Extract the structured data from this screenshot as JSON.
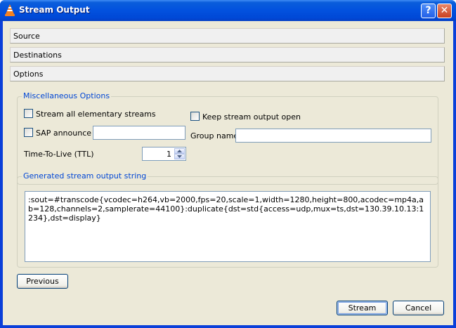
{
  "window": {
    "title": "Stream Output",
    "help_label": "?",
    "close_label": "✕",
    "colors": {
      "titlebar": "#0251de",
      "client": "#ece9d8",
      "accent_text": "#0046d5"
    }
  },
  "sections": {
    "source": "Source",
    "destinations": "Destinations",
    "options": "Options"
  },
  "misc": {
    "legend": "Miscellaneous Options",
    "stream_all_label": "Stream all elementary streams",
    "stream_all_checked": false,
    "keep_open_label": "Keep stream output open",
    "keep_open_checked": false,
    "sap_label": "SAP announce",
    "sap_checked": false,
    "sap_value": "",
    "group_name_label": "Group name",
    "group_name_value": "",
    "ttl_label": "Time-To-Live (TTL)",
    "ttl_value": "1"
  },
  "output": {
    "legend": "Generated stream output string",
    "value": ":sout=#transcode{vcodec=h264,vb=2000,fps=20,scale=1,width=1280,height=800,acodec=mp4a,ab=128,channels=2,samplerate=44100}:duplicate{dst=std{access=udp,mux=ts,dst=130.39.10.13:1234},dst=display}"
  },
  "buttons": {
    "previous": "Previous",
    "stream": "Stream",
    "cancel": "Cancel"
  }
}
